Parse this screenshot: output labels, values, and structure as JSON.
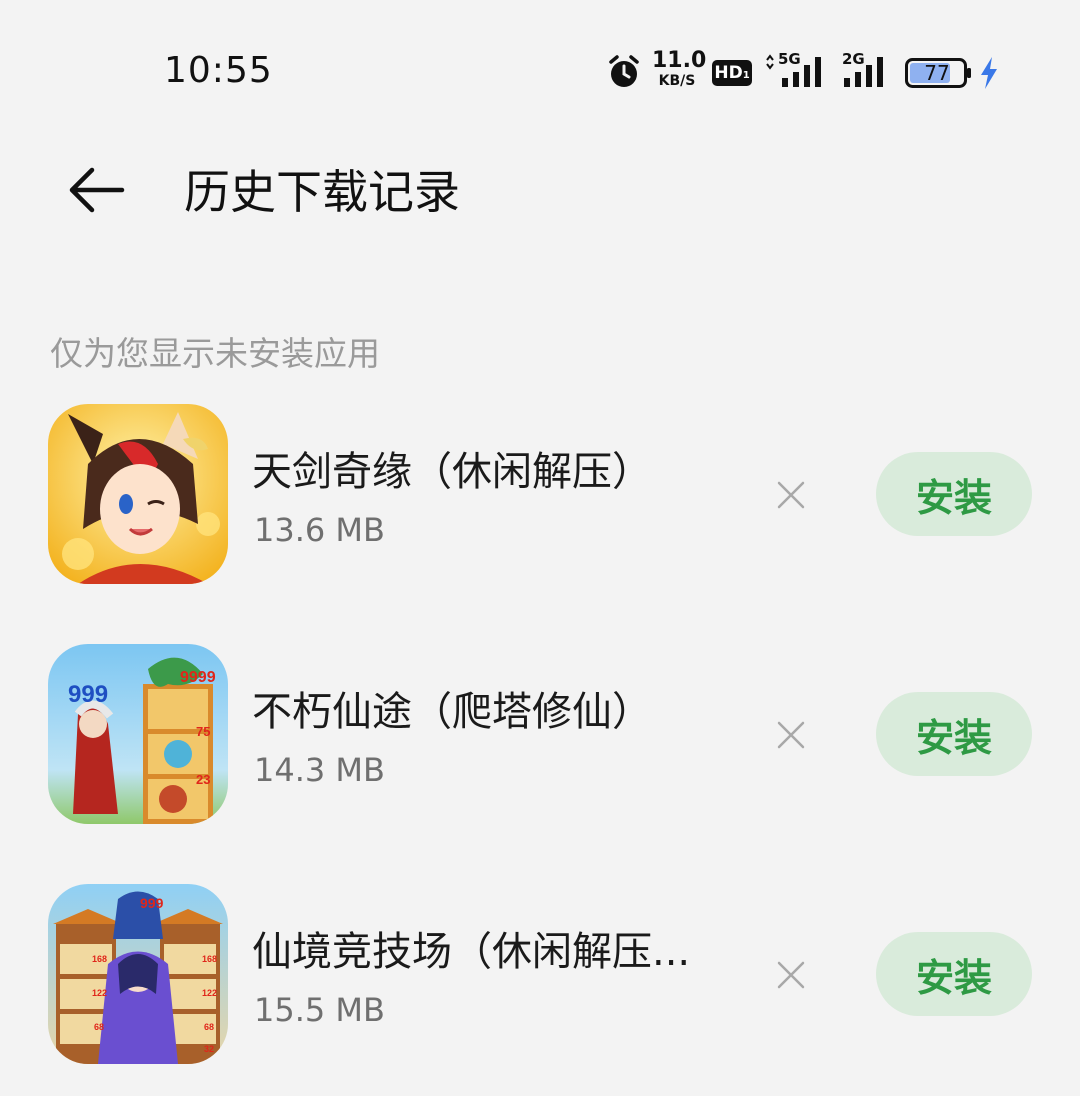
{
  "status_bar": {
    "time": "10:55",
    "net_speed_value": "11.0",
    "net_speed_unit": "KB/S",
    "hd_label": "HD",
    "hd_sub": "1",
    "sig1_label": "5G",
    "sig2_label": "2G",
    "battery_level": "77",
    "battery_fill_fraction": 0.77,
    "icons": [
      "alarm-icon",
      "signal-5g-icon",
      "signal-2g-icon",
      "battery-icon",
      "charging-icon"
    ]
  },
  "header": {
    "title": "历史下载记录",
    "back_icon": "arrow-left-icon"
  },
  "note": "仅为您显示未安装应用",
  "apps": [
    {
      "name": "天剑奇缘（休闲解压）",
      "size": "13.6 MB",
      "install_label": "安装"
    },
    {
      "name": "不朽仙途（爬塔修仙）",
      "size": "14.3 MB",
      "install_label": "安装"
    },
    {
      "name": "仙境竞技场（休闲解压...",
      "size": "15.5 MB",
      "install_label": "安装"
    }
  ],
  "app_icon_text": {
    "app2_a": "999",
    "app2_b": "9999",
    "app2_c": "75",
    "app2_d": "23",
    "app3_a": "999",
    "app3_b": "168",
    "app3_c": "122",
    "app3_d": "68",
    "app3_e": "32"
  },
  "colors": {
    "background": "#f3f3f3",
    "install_bg": "#d9ebdb",
    "install_text": "#2e9a44",
    "battery_fill": "#8fb1f0",
    "charge": "#3a78e8"
  }
}
